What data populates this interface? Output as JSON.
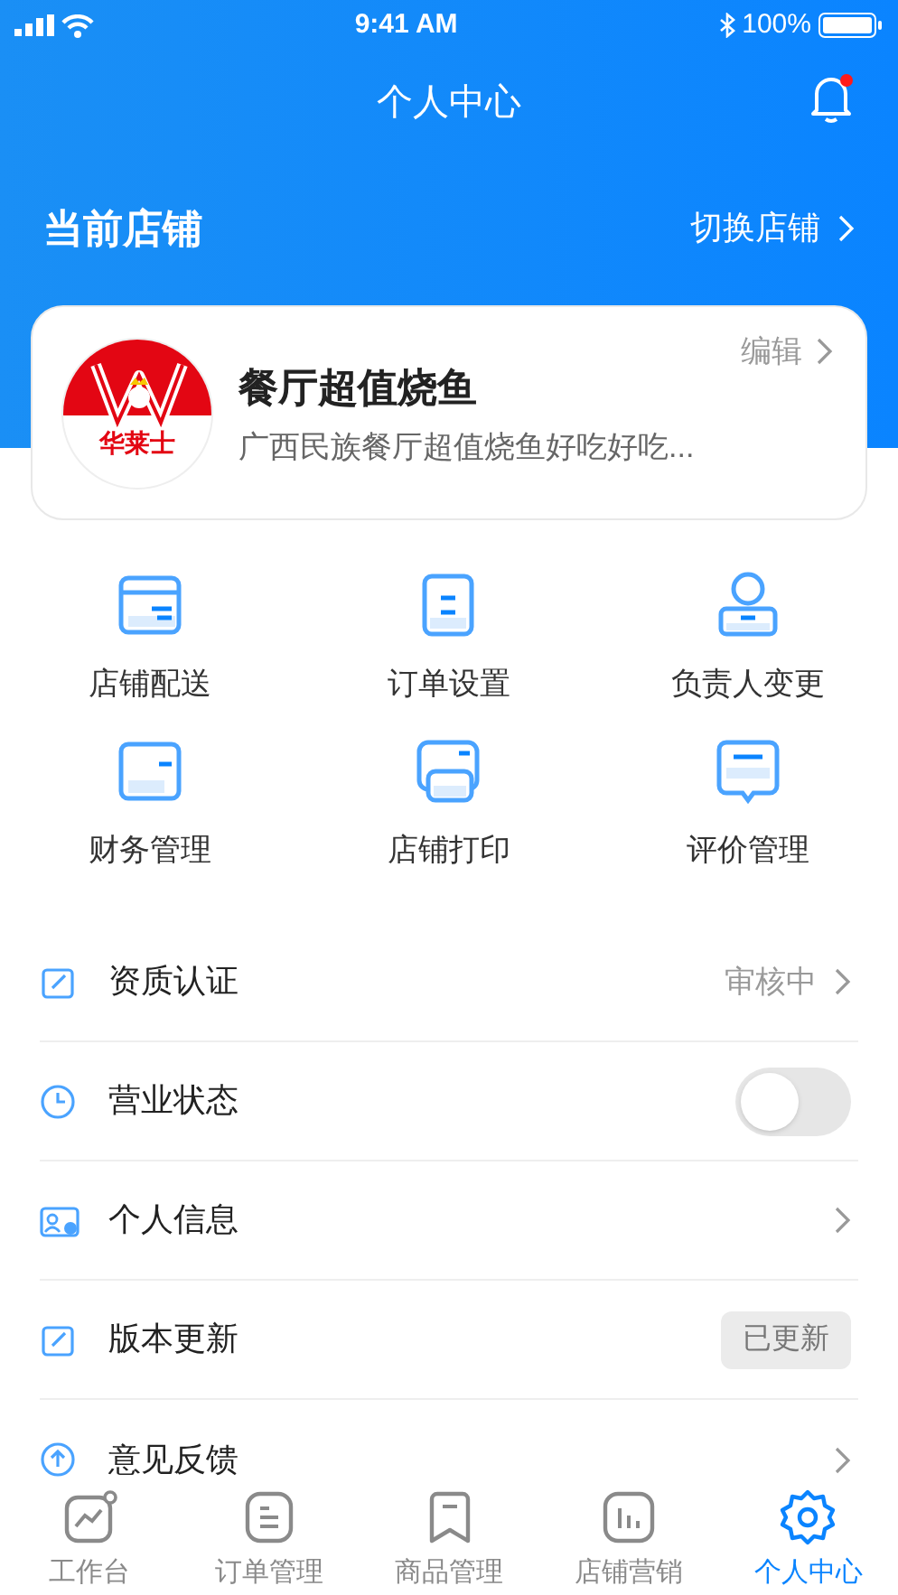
{
  "status_bar": {
    "time": "9:41 AM",
    "battery": "100%"
  },
  "header": {
    "title": "个人中心",
    "has_notification": true
  },
  "store_section": {
    "title": "当前店铺",
    "switch_link": "切换店铺"
  },
  "store_card": {
    "name": "餐厅超值烧鱼",
    "description": "广西民族餐厅超值烧鱼好吃好吃...",
    "edit_link": "编辑",
    "logo_text": "华莱士"
  },
  "shortcuts": [
    {
      "label": "店铺配送"
    },
    {
      "label": "订单设置"
    },
    {
      "label": "负责人变更"
    },
    {
      "label": "财务管理"
    },
    {
      "label": "店铺打印"
    },
    {
      "label": "评价管理"
    }
  ],
  "settings": [
    {
      "label": "资质认证",
      "kind": "status",
      "value": "审核中"
    },
    {
      "label": "营业状态",
      "kind": "toggle",
      "on": false
    },
    {
      "label": "个人信息",
      "kind": "link"
    },
    {
      "label": "版本更新",
      "kind": "badge",
      "value": "已更新"
    },
    {
      "label": "意见反馈",
      "kind": "link"
    }
  ],
  "tab_bar": [
    {
      "label": "工作台",
      "selected": false
    },
    {
      "label": "订单管理",
      "selected": false
    },
    {
      "label": "商品管理",
      "selected": false
    },
    {
      "label": "店铺营销",
      "selected": false
    },
    {
      "label": "个人中心",
      "selected": true
    }
  ]
}
